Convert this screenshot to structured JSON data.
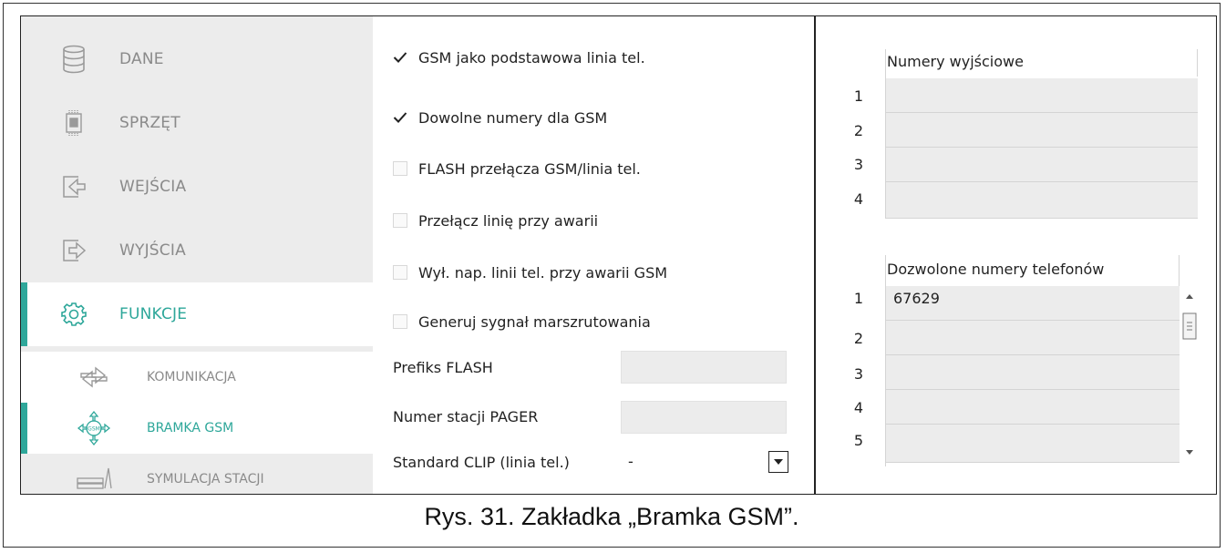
{
  "sidebar": {
    "items": [
      {
        "label": "DANE",
        "icon": "database-icon"
      },
      {
        "label": "SPRZĘT",
        "icon": "chip-icon"
      },
      {
        "label": "WEJŚCIA",
        "icon": "input-icon"
      },
      {
        "label": "WYJŚCIA",
        "icon": "output-icon"
      },
      {
        "label": "FUNKCJE",
        "icon": "gear-icon"
      }
    ],
    "sub_items": [
      {
        "label": "KOMUNIKACJA",
        "icon": "exchange-icon"
      },
      {
        "label": "BRAMKA GSM",
        "icon": "gsm-icon"
      },
      {
        "label": "SYMULACJA STACJI",
        "icon": "station-icon"
      }
    ]
  },
  "options": {
    "gsm_primary": {
      "label": "GSM jako podstawowa linia tel.",
      "checked": true
    },
    "any_numbers": {
      "label": "Dowolne numery dla GSM",
      "checked": true
    },
    "flash_switch": {
      "label": "FLASH przełącza GSM/linia tel.",
      "checked": false
    },
    "switch_on_fail": {
      "label": "Przełącz linię przy awarii",
      "checked": false
    },
    "disable_voltage": {
      "label": "Wył. nap. linii tel. przy awarii GSM",
      "checked": false
    },
    "routing_signal": {
      "label": "Generuj sygnał marszrutowania",
      "checked": false
    }
  },
  "fields": {
    "flash_prefix": {
      "label": "Prefiks FLASH",
      "value": ""
    },
    "pager_station": {
      "label": "Numer stacji PAGER",
      "value": ""
    },
    "clip_standard": {
      "label": "Standard CLIP (linia tel.)",
      "value": "-"
    }
  },
  "output_numbers": {
    "header": "Numery wyjściowe",
    "rows": [
      {
        "n": "1",
        "v": ""
      },
      {
        "n": "2",
        "v": ""
      },
      {
        "n": "3",
        "v": ""
      },
      {
        "n": "4",
        "v": ""
      }
    ]
  },
  "allowed_numbers": {
    "header": "Dozwolone numery telefonów",
    "rows": [
      {
        "n": "1",
        "v": "67629"
      },
      {
        "n": "2",
        "v": ""
      },
      {
        "n": "3",
        "v": ""
      },
      {
        "n": "4",
        "v": ""
      },
      {
        "n": "5",
        "v": ""
      }
    ]
  },
  "caption": "Rys. 31. Zakładka „Bramka GSM”."
}
